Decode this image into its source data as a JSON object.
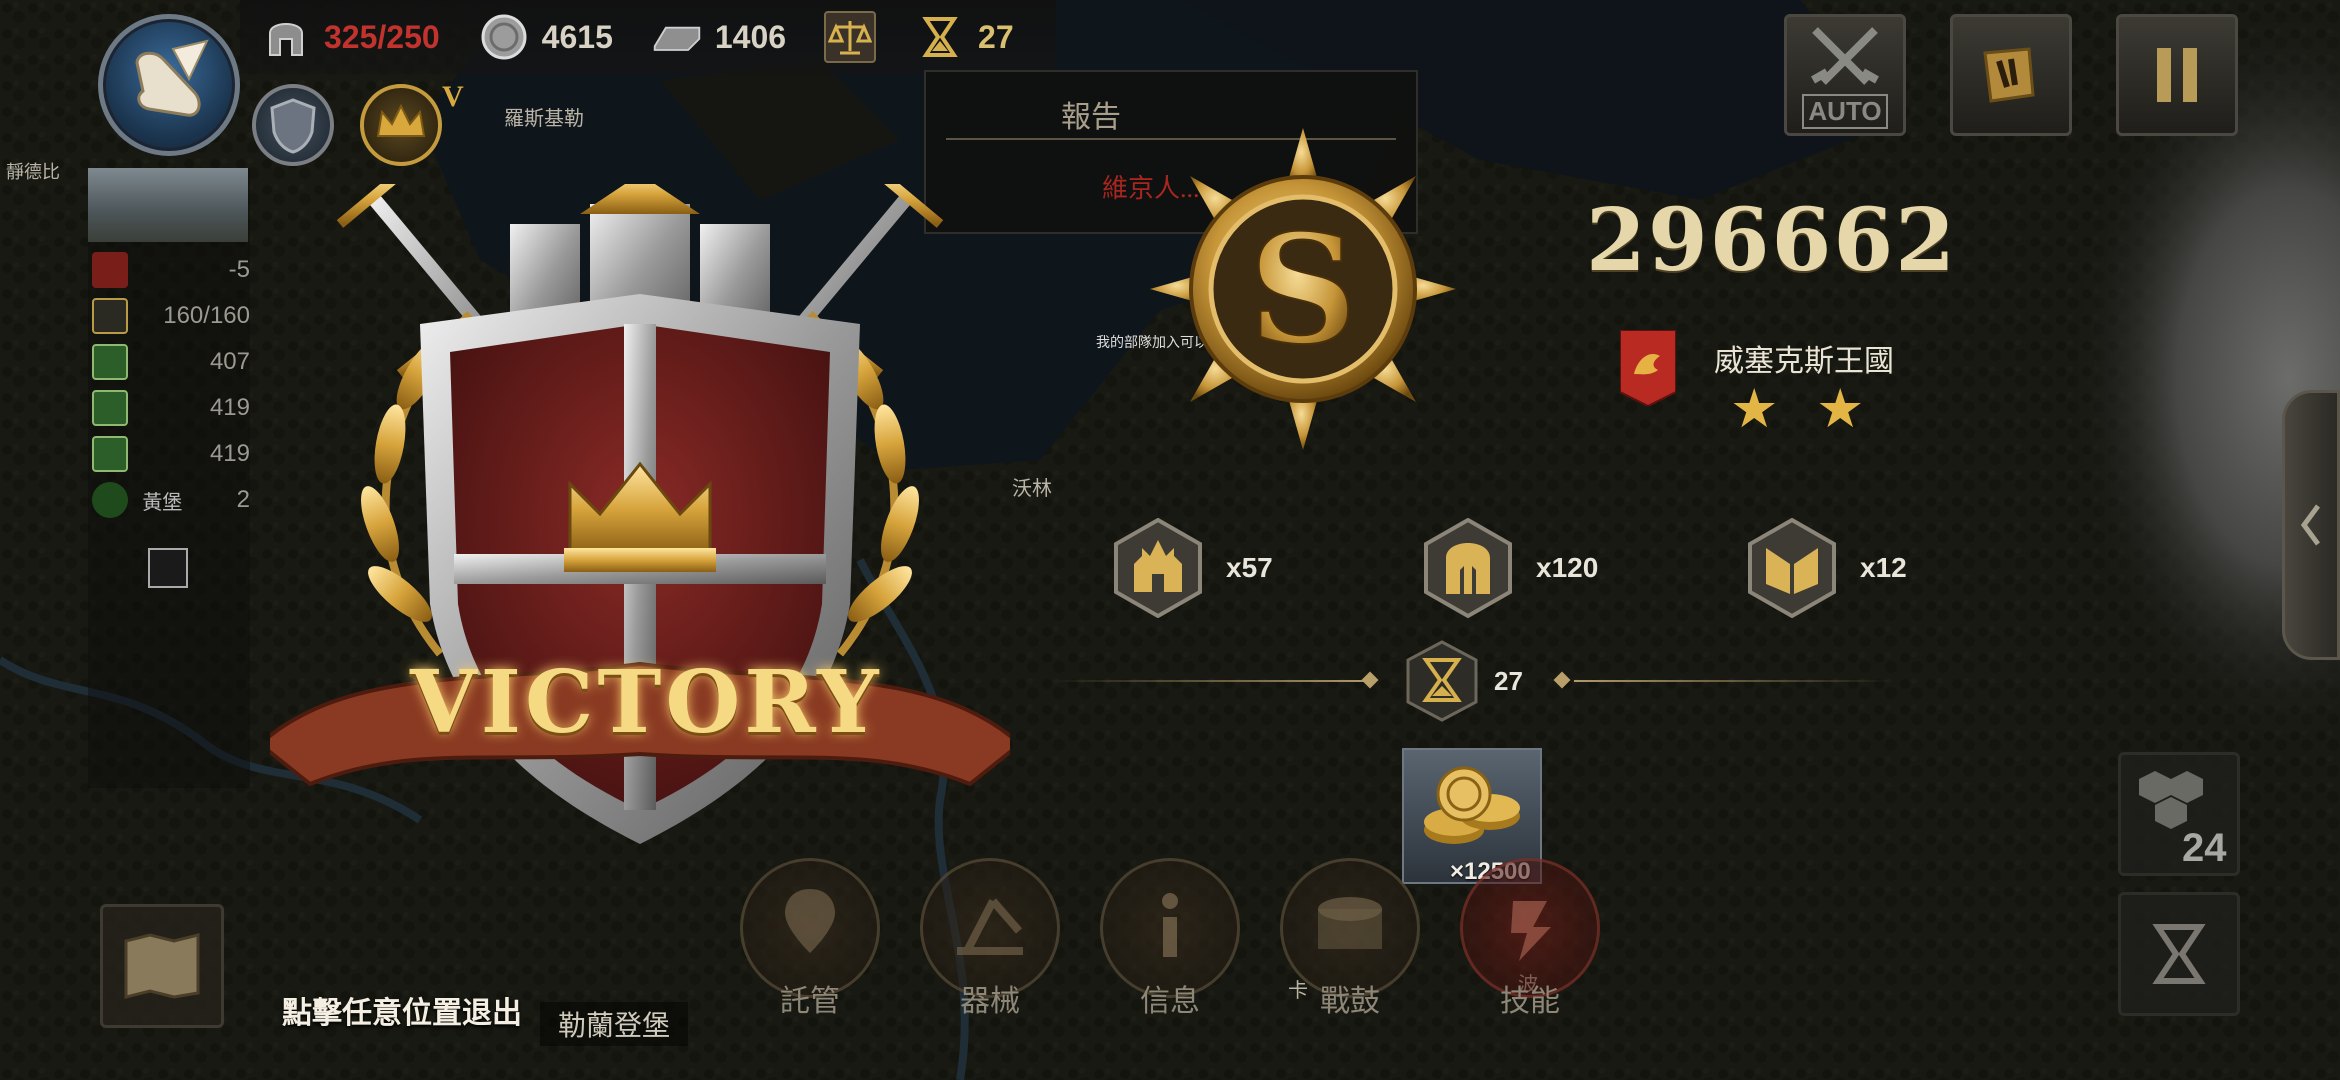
{
  "resources": {
    "troops": "325/250",
    "silver": "4615",
    "iron": "1406",
    "turns": "27"
  },
  "profile": {
    "rank": "V"
  },
  "map_labels": {
    "city_top": "羅斯基勒",
    "city_mid": "沃林",
    "city_small": "卡",
    "city_bottom": "勒蘭登堡",
    "city_right": "波",
    "region_left": "靜德比",
    "keep_name": "黃堡",
    "army_label": "我的部隊加入可以"
  },
  "left_stats": [
    {
      "icon": "boot-icon",
      "value": "-5"
    },
    {
      "icon": "helmet-icon",
      "value": "160/160"
    },
    {
      "icon": "horse-icon",
      "value": "407"
    },
    {
      "icon": "horse-icon",
      "value": "419"
    },
    {
      "icon": "horse-icon",
      "value": "419"
    },
    {
      "icon": "boot-icon",
      "value": "2"
    }
  ],
  "report": {
    "title": "報告",
    "message": "維京人..."
  },
  "top_buttons": {
    "auto_label": "AUTO"
  },
  "result": {
    "banner": "VICTORY",
    "grade": "S",
    "score": "296662",
    "kingdom": "威塞克斯王國",
    "stars": 2,
    "star_glyph": "★"
  },
  "rewards": [
    {
      "icon": "cathedral-icon",
      "count": "x57"
    },
    {
      "icon": "spartan-helmet-icon",
      "count": "x120"
    },
    {
      "icon": "banner-icon",
      "count": "x12"
    }
  ],
  "turn_reward": {
    "icon": "hourglass-icon",
    "count": "27"
  },
  "gold_reward": {
    "icon": "gold-coins-icon",
    "count": "×12500"
  },
  "action_buttons": [
    {
      "icon": "map-pin-icon",
      "label": "託管"
    },
    {
      "icon": "catapult-icon",
      "label": "器械"
    },
    {
      "icon": "info-icon",
      "label": "信息"
    },
    {
      "icon": "drum-icon",
      "label": "戰鼓"
    },
    {
      "icon": "skill-icon",
      "label": "技能"
    }
  ],
  "exit_hint": "點擊任意位置退出",
  "side": {
    "hex_count": "24"
  },
  "colors": {
    "warning": "#c2332e",
    "gold": "#e3b544",
    "score": "#e5d7aa",
    "shield_red": "#6d1f1e"
  }
}
